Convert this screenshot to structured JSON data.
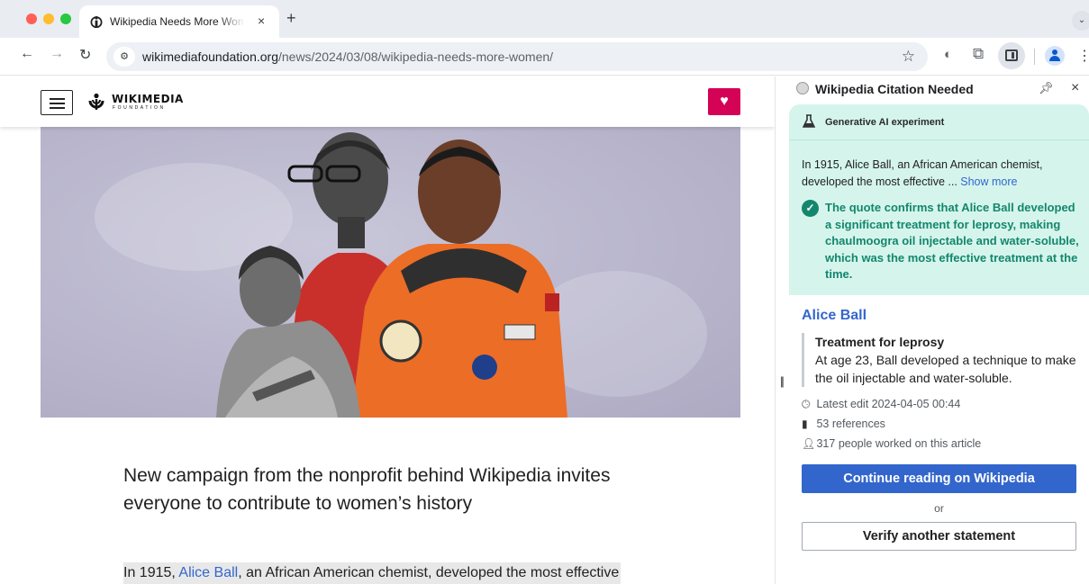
{
  "browser": {
    "tab": {
      "title": "Wikipedia Needs More Women",
      "close": "×"
    },
    "new_tab": "+",
    "url_host": "wikimediafoundation.org",
    "url_path": "/news/2024/03/08/wikipedia-needs-more-women/",
    "icons": [
      "back-arrow-icon",
      "forward-arrow-icon",
      "reload-icon",
      "site-info-icon",
      "bookmark-star-icon",
      "extension-icon",
      "puzzle-icon",
      "side-panel-icon",
      "profile-icon",
      "kebab-menu-icon"
    ]
  },
  "page": {
    "logo_name": "WIKIMEDIA",
    "logo_sub": "FOUNDATION",
    "headline": "New campaign from the nonprofit behind Wikipedia invites everyone to contribute to women’s history",
    "body_prefix": "In 1915, ",
    "body_link": "Alice Ball",
    "body_suffix": ", an African American chemist, developed the most effective",
    "accent_color": "#d40356"
  },
  "side_panel": {
    "title": "Wikipedia Citation Needed",
    "ai_label": "Generative AI experiment",
    "quote": "In 1915, Alice Ball, an African American chemist, developed the most effective ... ",
    "show_more": "Show more",
    "verdict": "The quote confirms that Alice Ball developed a significant treatment for leprosy, making chaulmoogra oil injectable and water-soluble, which was the most effective treatment at the time.",
    "article_title": "Alice Ball",
    "snippet_heading": "Treatment for leprosy",
    "snippet_text": "At age 23, Ball developed a technique to make the oil injectable and water-soluble.",
    "latest_edit": "Latest edit 2024-04-05 00:44",
    "references": "53 references",
    "contributors": "317 people worked on this article",
    "continue_button": "Continue reading on Wikipedia",
    "or_label": "or",
    "verify_button": "Verify another statement",
    "success_color": "#14866d",
    "link_color": "#3366cc"
  }
}
